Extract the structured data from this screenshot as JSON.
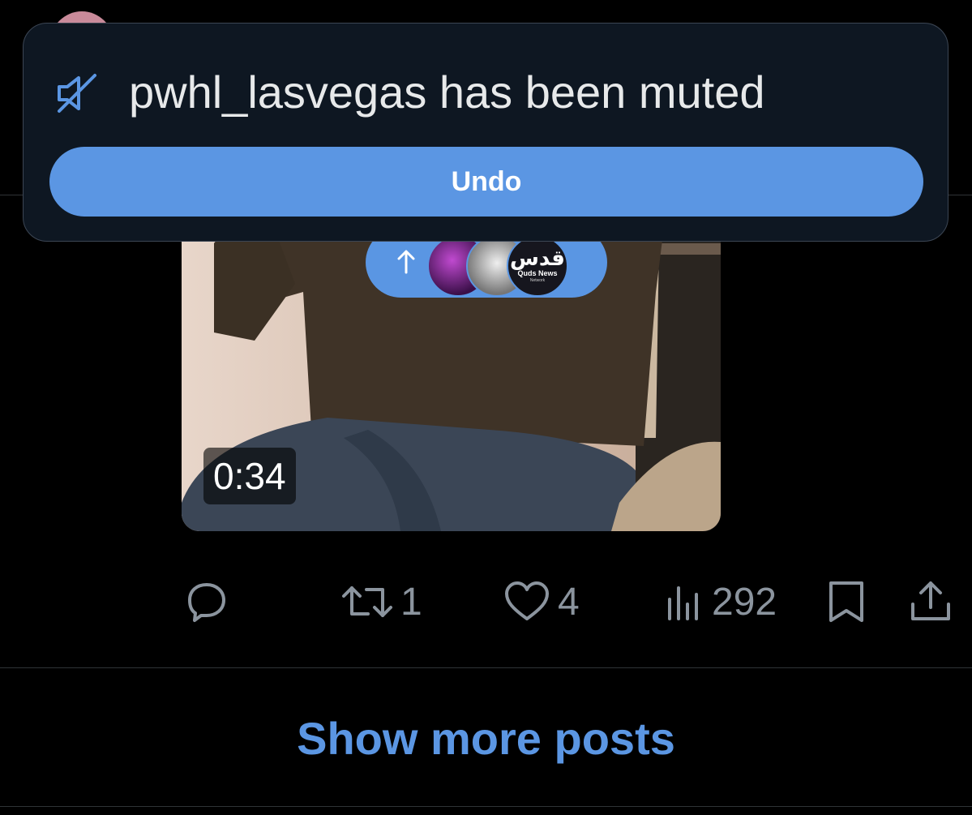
{
  "toast": {
    "icon": "speaker-muted-icon",
    "message": "pwhl_lasvegas has been muted",
    "undo_label": "Undo"
  },
  "video": {
    "duration": "0:34"
  },
  "new_posts_pill": {
    "arrow_icon": "arrow-up-icon",
    "avatar_logo_text": "قدس",
    "avatar_caption": "Quds News",
    "avatar_caption_sub": "Network"
  },
  "actions": {
    "reply": {
      "icon": "reply-icon",
      "count": ""
    },
    "repost": {
      "icon": "repost-icon",
      "count": "1"
    },
    "like": {
      "icon": "heart-icon",
      "count": "4"
    },
    "views": {
      "icon": "views-icon",
      "count": "292"
    },
    "bookmark": {
      "icon": "bookmark-icon"
    },
    "share": {
      "icon": "share-icon"
    }
  },
  "show_more_label": "Show more posts",
  "colors": {
    "accent": "#5b96e3",
    "toast_bg": "#0e1722",
    "muted_text": "#8b949e",
    "background": "#000000"
  }
}
